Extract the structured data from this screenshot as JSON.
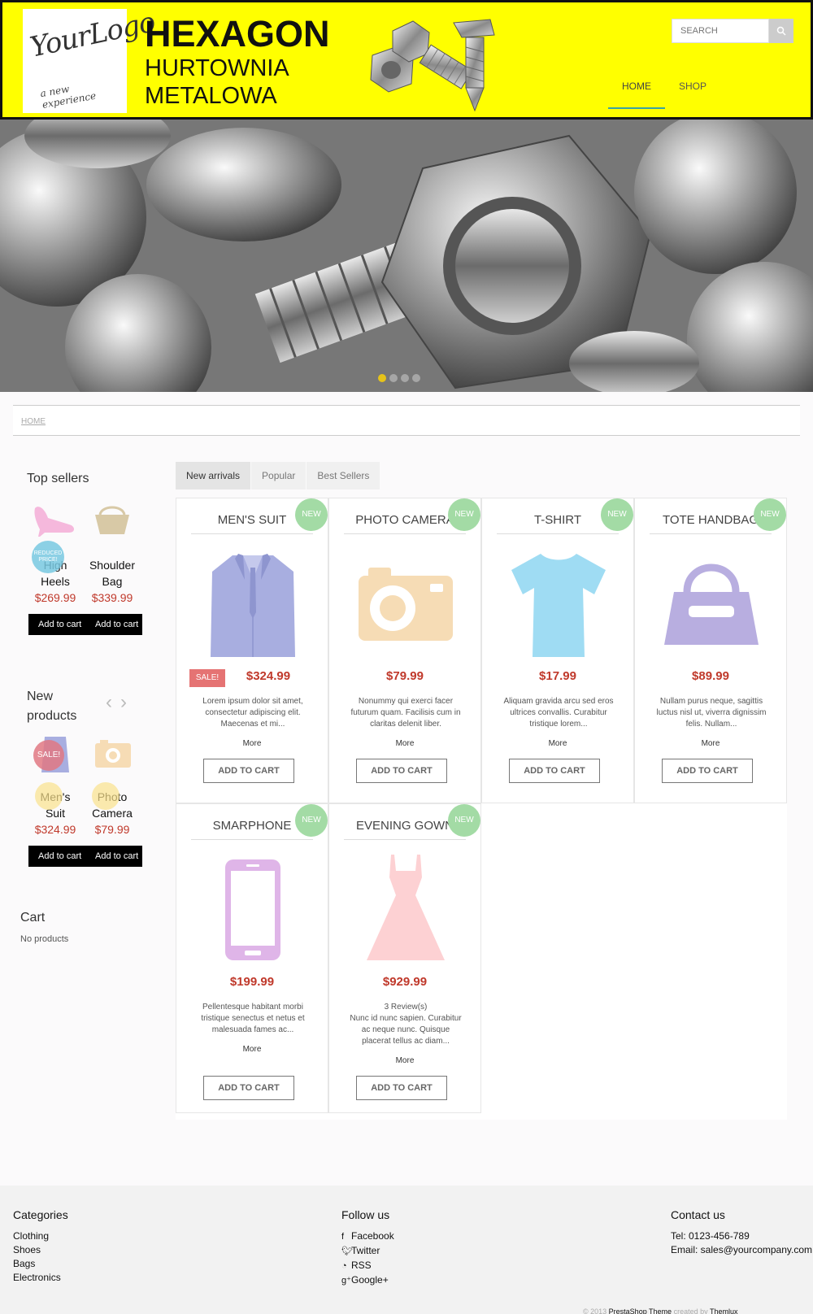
{
  "header": {
    "logo": {
      "script": "YourLogo",
      "tagline": "a new experience"
    },
    "brand": {
      "line1": "HEXAGON",
      "line2": "HURTOWNIA",
      "line3": "METALOWA"
    },
    "search": {
      "placeholder": "SEARCH",
      "icon": "search-icon"
    },
    "nav": [
      {
        "label": "HOME",
        "active": true
      },
      {
        "label": "SHOP",
        "active": false
      }
    ]
  },
  "slider": {
    "dots": 4,
    "active_dot": 0,
    "accent": "#e6c31a"
  },
  "breadcrumb": {
    "home": "HOME"
  },
  "sidebar": {
    "top_sellers": {
      "title": "Top sellers",
      "items": [
        {
          "name1": "High",
          "name2": "Heels",
          "price": "$269.99",
          "button": "Add to cart",
          "badge": "REDUCED PRICE!"
        },
        {
          "name1": "Shoulder",
          "name2": "Bag",
          "price": "$339.99",
          "button": "Add to cart"
        }
      ]
    },
    "new_products": {
      "title1": "New",
      "title2": "products",
      "items": [
        {
          "name1": "Men's",
          "name2": "Suit",
          "price": "$324.99",
          "button": "Add to cart",
          "badge": "SALE!"
        },
        {
          "name1": "Photo",
          "name2": "Camera",
          "price": "$79.99",
          "button": "Add to cart"
        }
      ]
    },
    "cart": {
      "title": "Cart",
      "empty": "No products"
    }
  },
  "tabs": [
    {
      "label": "New arrivals",
      "active": true
    },
    {
      "label": "Popular",
      "active": false
    },
    {
      "label": "Best Sellers",
      "active": false
    }
  ],
  "products": [
    {
      "name": "MEN'S SUIT",
      "badge": "NEW",
      "price": "$324.99",
      "sale": "SALE!",
      "desc": "Lorem ipsum dolor sit amet, consectetur adipiscing elit. Maecenas et mi...",
      "more": "More",
      "button": "ADD TO CART",
      "icon": "suit-icon",
      "color": "#a8aee0"
    },
    {
      "name": "PHOTO CAMERA",
      "badge": "NEW",
      "price": "$79.99",
      "desc": "Nonummy qui exerci facer futurum quam. Facilisis cum in claritas delenit liber.",
      "more": "More",
      "button": "ADD TO CART",
      "icon": "camera-icon",
      "color": "#f6dcb5"
    },
    {
      "name": "T-SHIRT",
      "badge": "NEW",
      "price": "$17.99",
      "desc": "Aliquam gravida arcu sed eros ultrices convallis. Curabitur tristique lorem...",
      "more": "More",
      "button": "ADD TO CART",
      "icon": "tshirt-icon",
      "color": "#9fdcf3"
    },
    {
      "name": "TOTE HANDBAG",
      "badge": "NEW",
      "price": "$89.99",
      "desc": "Nullam purus neque, sagittis luctus nisl ut, viverra dignissim felis. Nullam...",
      "more": "More",
      "button": "ADD TO CART",
      "icon": "handbag-icon",
      "color": "#b8aee0"
    },
    {
      "name": "SMARPHONE",
      "badge": "NEW",
      "price": "$199.99",
      "desc": "Pellentesque habitant morbi tristique senectus et netus et malesuada fames ac...",
      "more": "More",
      "button": "ADD TO CART",
      "icon": "smartphone-icon",
      "color": "#dfb5e8"
    },
    {
      "name": "EVENING GOWN",
      "badge": "NEW",
      "price": "$929.99",
      "reviews": "3 Review(s)",
      "desc": "Nunc id nunc sapien. Curabitur ac neque nunc. Quisque placerat tellus ac diam...",
      "more": "More",
      "button": "ADD TO CART",
      "icon": "dress-icon",
      "color": "#fdd1d3"
    }
  ],
  "footer": {
    "categories": {
      "title": "Categories",
      "items": [
        "Clothing",
        "Shoes",
        "Bags",
        "Electronics"
      ]
    },
    "follow": {
      "title": "Follow us",
      "items": [
        {
          "label": "Facebook",
          "icon": "facebook-icon"
        },
        {
          "label": "Twitter",
          "icon": "twitter-icon"
        },
        {
          "label": "RSS",
          "icon": "rss-icon"
        },
        {
          "label": "Google+",
          "icon": "googleplus-icon"
        }
      ]
    },
    "contact": {
      "title": "Contact us",
      "tel": "Tel: 0123-456-789",
      "email": "Email: sales@yourcompany.com"
    },
    "credit": {
      "prefix": "© 2013",
      "theme": "PrestaShop Theme",
      "by": "created by",
      "author": "Themlux"
    }
  },
  "colors": {
    "header_bg": "#ffff00",
    "price": "#c0392b",
    "new_badge": "#a3dba5",
    "nav_accent": "#3aa3a3"
  }
}
